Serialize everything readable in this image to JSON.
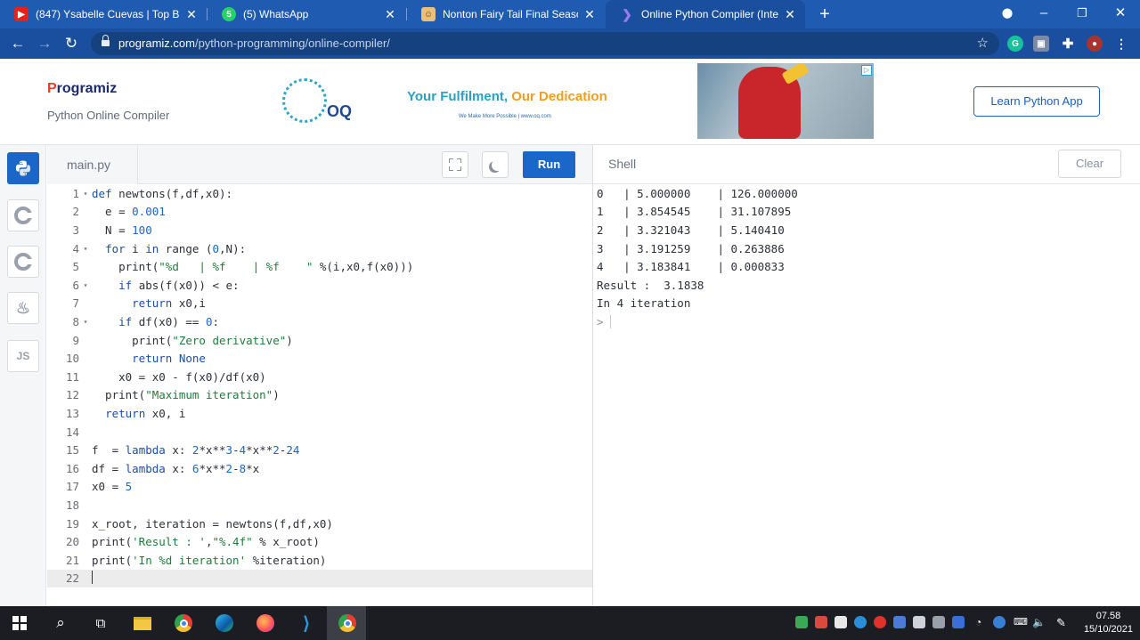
{
  "browser": {
    "tabs": [
      {
        "title": "(847) Ysabelle Cuevas | Top Best ",
        "favicon": "youtube-icon"
      },
      {
        "title": "(5) WhatsApp",
        "favicon": "whatsapp-icon"
      },
      {
        "title": "Nonton Fairy Tail Final Season Ep",
        "favicon": "anime-site-icon"
      },
      {
        "title": "Online Python Compiler (Interpre",
        "favicon": "programiz-icon",
        "active": true
      }
    ],
    "url_host": "programiz.com",
    "url_path": "/python-programming/online-compiler/"
  },
  "header": {
    "logo_text": "rogramiz",
    "logo_p": "P",
    "subtitle": "Python Online Compiler",
    "ad": {
      "headline_a": "Your Fulfilment, ",
      "headline_b": "Our Dedication",
      "tagline": "We Make More Possible  |  www.oq.com",
      "brand": "OQ"
    },
    "learn_button": "Learn Python App"
  },
  "sidebar": {
    "langs": [
      "python",
      "c",
      "cpp",
      "java",
      "JS"
    ]
  },
  "editor": {
    "file_name": "main.py",
    "run_label": "Run",
    "lines": [
      {
        "n": "1",
        "fold": true
      },
      {
        "n": "2"
      },
      {
        "n": "3"
      },
      {
        "n": "4",
        "fold": true
      },
      {
        "n": "5"
      },
      {
        "n": "6",
        "fold": true
      },
      {
        "n": "7"
      },
      {
        "n": "8",
        "fold": true
      },
      {
        "n": "9"
      },
      {
        "n": "10"
      },
      {
        "n": "11"
      },
      {
        "n": "12"
      },
      {
        "n": "13"
      },
      {
        "n": "14"
      },
      {
        "n": "15"
      },
      {
        "n": "16"
      },
      {
        "n": "17"
      },
      {
        "n": "18"
      },
      {
        "n": "19"
      },
      {
        "n": "20"
      },
      {
        "n": "21"
      },
      {
        "n": "22"
      }
    ],
    "code": [
      "def newtons(f,df,x0):",
      "  e = 0.001",
      "  N = 100",
      "  for i in range (0,N):",
      "    print(\"%d   | %f    | %f    \" %(i,x0,f(x0)))",
      "    if abs(f(x0)) < e:",
      "      return x0,i",
      "    if df(x0) == 0:",
      "      print(\"Zero derivative\")",
      "      return None",
      "    x0 = x0 - f(x0)/df(x0)",
      "  print(\"Maximum iteration\")",
      "  return x0, i",
      "",
      "f  = lambda x: 2*x**3-4*x**2-24",
      "df = lambda x: 6*x**2-8*x",
      "x0 = 5",
      "",
      "x_root, iteration = newtons(f,df,x0)",
      "print('Result : ',\"%.4f\" % x_root)",
      "print('In %d iteration' %iteration)",
      ""
    ]
  },
  "shell": {
    "label": "Shell",
    "clear_label": "Clear",
    "output": [
      "0   | 5.000000    | 126.000000",
      "1   | 3.854545    | 31.107895",
      "2   | 3.321043    | 5.140410",
      "3   | 3.191259    | 0.263886",
      "4   | 3.183841    | 0.000833",
      "Result :  3.1838",
      "In 4 iteration"
    ],
    "prompt": ">"
  },
  "taskbar": {
    "time": "07.58",
    "date": "15/10/2021"
  },
  "colors": {
    "accent": "#1b66c9",
    "chrome": "#1a4fa0"
  }
}
